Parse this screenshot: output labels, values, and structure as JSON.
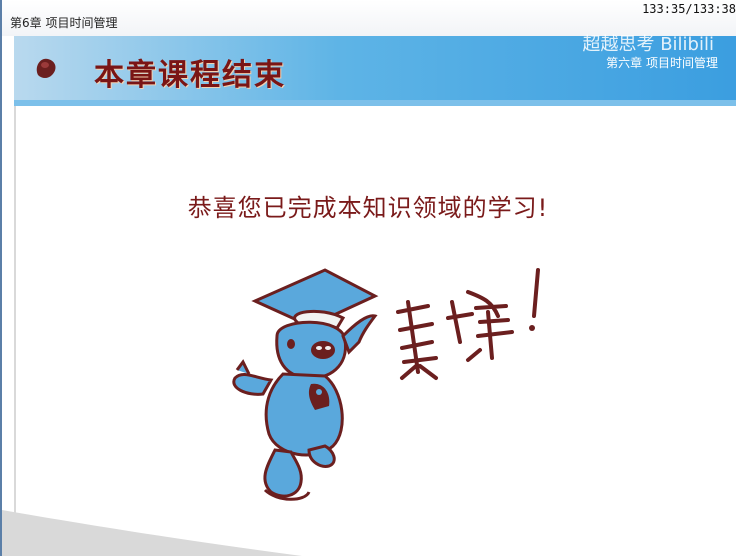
{
  "window": {
    "chapter_label": "第6章 项目时间管理",
    "time_readout": "133:35/133:38"
  },
  "header": {
    "title": "本章课程结束",
    "subtitle": "第六章 项目时间管理",
    "watermark": "超越思考 Bilibili"
  },
  "main": {
    "message": "恭喜您已完成本知识领域的学习!",
    "handwriting": "真棒!"
  },
  "colors": {
    "title": "#7a1515",
    "header_band": "#3b9ee0",
    "mascot_blue": "#5aa8dc",
    "mascot_brown": "#6b1f1f"
  },
  "icons": {
    "bullet": "bullet-icon",
    "mascot": "graduate-pig-mascot"
  }
}
